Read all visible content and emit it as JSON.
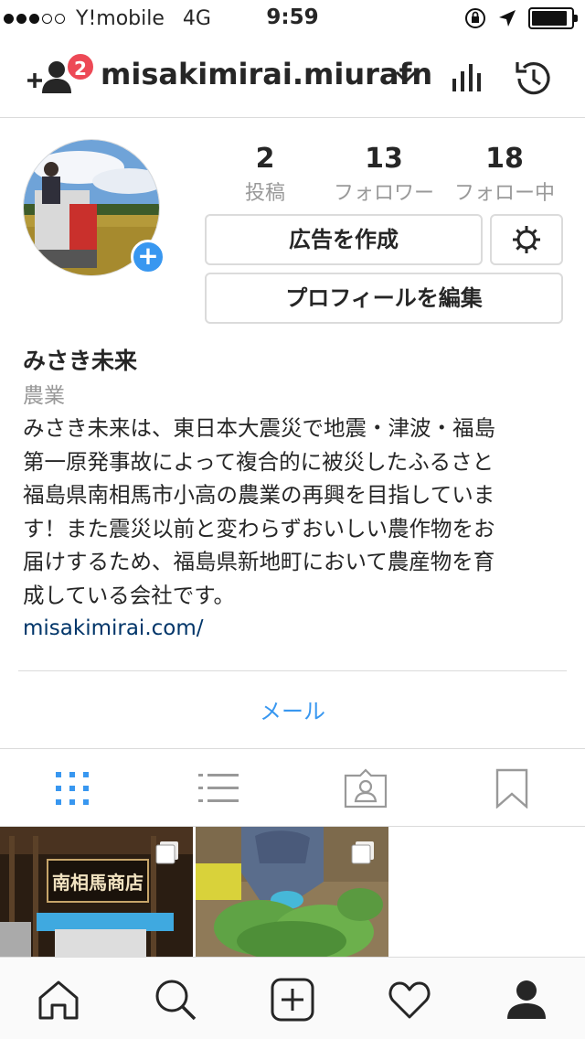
{
  "status_bar": {
    "carrier": "Y!mobile",
    "network": "4G",
    "time": "9:59",
    "signal_bars_filled": 3,
    "signal_bars_total": 5,
    "battery_level": 0.9
  },
  "header": {
    "username": "misakimirai.miurafn",
    "notification_count": "2",
    "icons": [
      "add-person-icon",
      "chevron-down-icon",
      "insights-icon",
      "archive-icon"
    ]
  },
  "profile": {
    "stats": [
      {
        "count": "2",
        "label": "投稿"
      },
      {
        "count": "13",
        "label": "フォロワー"
      },
      {
        "count": "18",
        "label": "フォロー中"
      }
    ],
    "create_ad_label": "広告を作成",
    "edit_profile_label": "プロフィールを編集",
    "name": "みさき未来",
    "category": "農業",
    "bio_lines": [
      "みさき未来は、東日本大震災で地震・津波・福島",
      "第一原発事故によって複合的に被災したふるさと",
      "福島県南相馬市小高の農業の再興を目指していま",
      "す！また震災以前と変わらずおいしい農作物をお",
      "届けするため、福島県新地町において農産物を育",
      "成している会社です。"
    ],
    "website": "misakimirai.com/",
    "email_label": "メール"
  },
  "tabs": [
    "grid-icon",
    "list-icon",
    "tagged-icon",
    "saved-icon"
  ],
  "posts": [
    {
      "description_icon": "multi-photo-icon"
    },
    {
      "description_icon": "multi-photo-icon"
    }
  ],
  "post_sign_text": "南相馬商店",
  "bottom_nav": [
    "home-icon",
    "search-icon",
    "new-post-icon",
    "activity-icon",
    "profile-icon"
  ],
  "colors": {
    "accent_blue": "#3897f0",
    "badge_red": "#ed4956",
    "link_navy": "#003569",
    "muted_gray": "#999999"
  }
}
